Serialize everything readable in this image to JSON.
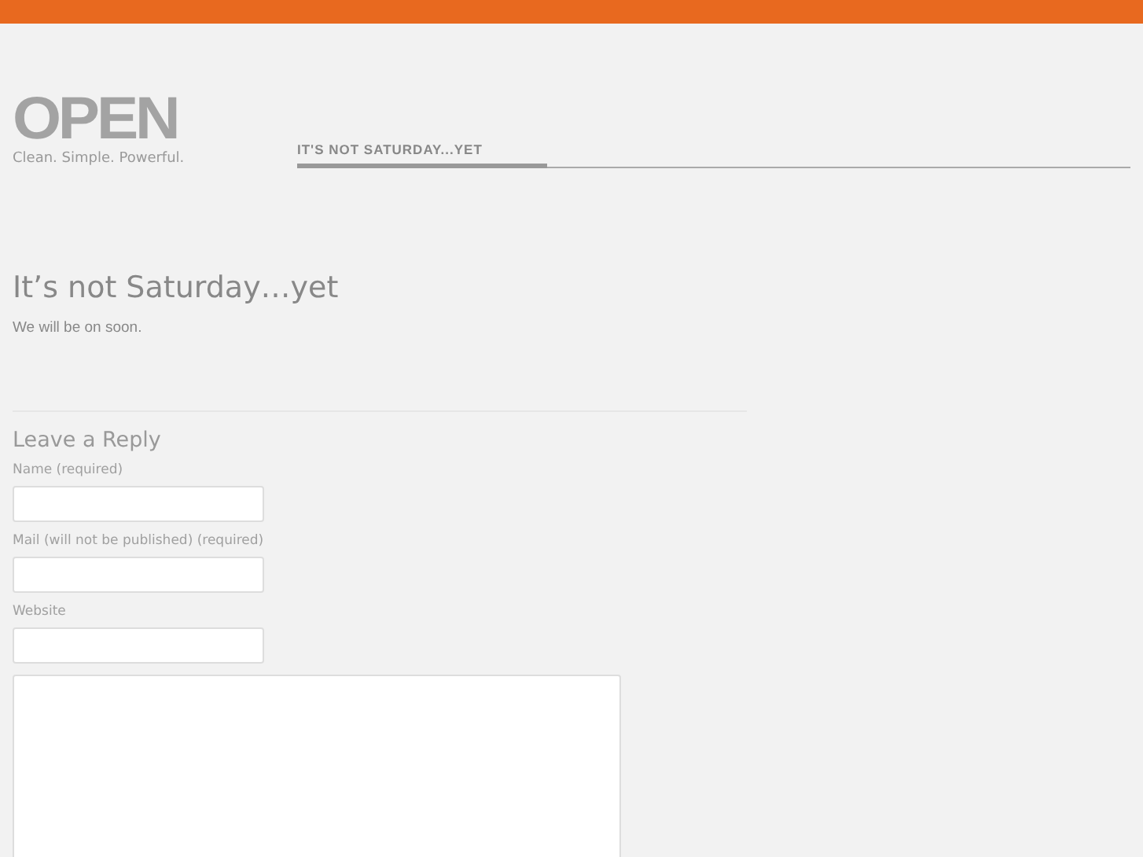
{
  "logo": {
    "name": "OPEN",
    "tagline": "Clean. Simple. Powerful."
  },
  "nav": [
    {
      "label": "IT'S NOT SATURDAY...YET",
      "selected": true
    }
  ],
  "post": {
    "title": "It’s not Saturday…yet",
    "body": "We will be on soon."
  },
  "reply": {
    "heading": "Leave a Reply",
    "fields": [
      {
        "label": "Name (required)"
      },
      {
        "label": "Mail (will not be published) (required)"
      },
      {
        "label": "Website"
      }
    ]
  }
}
